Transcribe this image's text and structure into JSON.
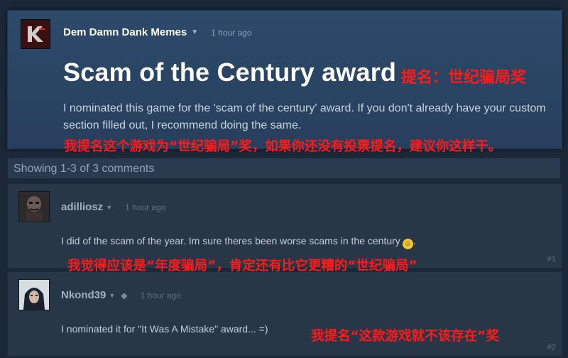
{
  "post": {
    "author": "Dem Damn Dank Memes",
    "timestamp": "1 hour ago",
    "title": "Scam of the Century award",
    "body": "I nominated this game for the 'scam of the century' award. If you don't already have your custom section filled out, I recommend doing the same.",
    "avatar_text": "KF",
    "avatar_icon": "kf-logo-avatar"
  },
  "overlays": {
    "title_translation": "提名：世纪骗局奖",
    "body_translation": "我提名这个游戏为“世纪骗局”奖，如果你还没有投票提名，建议你这样干。",
    "comment1_translation": "我觉得应该是“年度骗局”，肯定还有比它更糟的“世纪骗局”",
    "comment2_translation": "我提名“这款游戏就不该存在”奖"
  },
  "showing": {
    "text": "Showing 1-3 of 3 comments"
  },
  "comments": [
    {
      "author": "adilliosz",
      "timestamp": "1 hour ago",
      "text": "I did of the scam of the year. Im sure theres been worse scams in the century",
      "text_suffix": ".",
      "emoji_icon": "grin-sweat-emoji",
      "number": "#1"
    },
    {
      "author": "Nkond39",
      "timestamp": "1 hour ago",
      "text": "I nominated it for \"It Was A Mistake\" award... =)",
      "number": "#2"
    }
  ],
  "colors": {
    "background": "#1b2838",
    "post_panel": "#2d4a6b",
    "comment_panel": "#273748",
    "overlay_red": "#ff1a1a",
    "author_white": "#ffffff"
  }
}
